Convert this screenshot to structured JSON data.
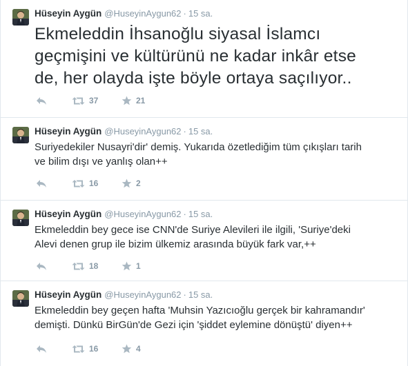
{
  "tweets": [
    {
      "fullname": "Hüseyin Aygün",
      "username": "@HuseyinAygun62",
      "separator": "·",
      "time": "15 sa.",
      "lines": [
        "Ekmeleddin İhsanoğlu siyasal İslamcı",
        "geçmişini ve kültürünü ne kadar inkâr etse",
        "de, her olayda işte böyle ortaya saçılıyor.."
      ],
      "retweets": "37",
      "favorites": "21"
    },
    {
      "fullname": "Hüseyin Aygün",
      "username": "@HuseyinAygun62",
      "separator": "·",
      "time": "15 sa.",
      "lines": [
        "Suriyedekiler Nusayri'dir' demiş. Yukarıda özetlediğim tüm çıkışları tarih",
        "ve bilim dışı ve yanlış olan++"
      ],
      "retweets": "16",
      "favorites": "2"
    },
    {
      "fullname": "Hüseyin Aygün",
      "username": "@HuseyinAygun62",
      "separator": "·",
      "time": "15 sa.",
      "lines": [
        "Ekmeleddin bey gece ise CNN'de Suriye Alevileri ile ilgili, 'Suriye'deki",
        "Alevi denen grup ile bizim ülkemiz arasında büyük fark var,++"
      ],
      "retweets": "18",
      "favorites": "1"
    },
    {
      "fullname": "Hüseyin Aygün",
      "username": "@HuseyinAygun62",
      "separator": "·",
      "time": "15 sa.",
      "lines": [
        "Ekmeleddin bey geçen hafta 'Muhsin Yazıcıoğlu gerçek bir kahramandır'",
        "demişti. Dünkü BirGün'de Gezi için 'şiddet eylemine dönüştü' diyen++"
      ],
      "retweets": "16",
      "favorites": "4"
    }
  ],
  "icons": {
    "reply": "reply-icon",
    "retweet": "retweet-icon",
    "favorite": "star-icon",
    "avatar": "profile-photo"
  },
  "colors": {
    "text": "#292f33",
    "meta": "#8899a6",
    "icon": "#aab8c2",
    "divider": "#e1e8ed"
  }
}
